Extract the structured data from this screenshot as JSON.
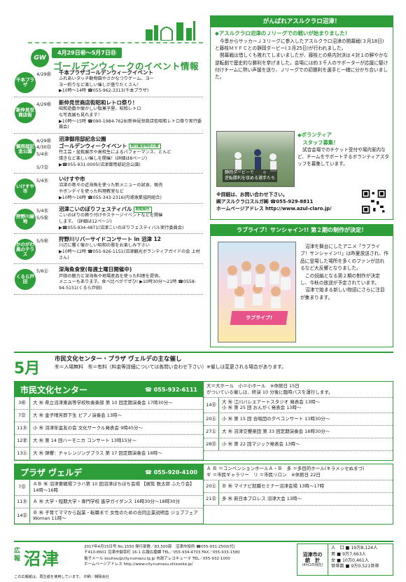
{
  "header": {
    "badge": "GW",
    "dates": "4月29日㊗～5月7日㊐",
    "title": "ゴールデンウィークのイベント情報"
  },
  "events": [
    {
      "loc": "千本プラザ",
      "date": "4/29㊗",
      "title": "千本プラザゴールデンウィークイベント",
      "lines": [
        "ふれあいタッチ動物園やさかなつりゲーム、ヨー",
        "ヨー釣りなど楽しい催しが盛りだくさん！",
        "▶10時～14時 ☎055-962-3313(千本プラザ)"
      ],
      "tag": ""
    },
    {
      "loc": "新仲見世商店街",
      "date": "4/29㊗",
      "title": "新仲見世商店街昭和レトロ祭り！",
      "lines": [
        "昭和遊戯や懐かしい駄菓子屋、昭和レトロ",
        "な写真展も見れます！",
        "▶10時～15時 ☎090-1984-7628(新仲見世商店街昭和レトロ祭り実行委員会)"
      ],
      "tag": ""
    },
    {
      "loc": "御用邸記念公園",
      "date": "4/29㊗\n4/30㊐\n5/4㊍\n\n5/7㊐",
      "title": "沼津御用邸記念公園\nゴールデンウィークイベント",
      "lines": [
        "竹工芸・盆栽展示や高校生によるパフォーマンス、とんど",
        "焼きなど楽しい催しを開催！(詳細は8ページ)",
        "▶☎055-931-0005(沼津御用邸記念公園)"
      ],
      "tag": "西付属邸特別公開"
    },
    {
      "loc": "いけすや市",
      "date": "5/4㊍",
      "title": "いけすや市",
      "lines": [
        "沼津の島々の近海魚を使った新メニューの試食、販売",
        "やボンデイを使った料理教室など",
        "▶10時～16時 ☎055-343-2316(内浦漁業協同組合)"
      ],
      "tag": ""
    },
    {
      "loc": "狩野川緑地",
      "date": "5/4㊍\n5/5㊗",
      "title": "沼津こいのぼりフェスティバル",
      "lines": [
        "こいのぼりの飾り付けやステージイベントなどを開催",
        "します。 (詳細は12ページ)",
        "▶☎055-934-4871(沼津こいのぼりフェスティバル実行委員会)"
      ],
      "tag": "期間展示"
    },
    {
      "loc": "かのがわ風のテラス",
      "date": "5/5㊗",
      "title": "狩野川リバーサイドコンサート in 沼津 12",
      "lines": [
        "川辺に響く懐かしい昭和の歌をお楽しみ下さい",
        "▶10時～12時 ☎055-926-1151(沼津観光ボランティアガイドの会 上村さん)"
      ],
      "tag": ""
    },
    {
      "loc": "くるら戸田",
      "date": "5/6㊏",
      "title": "深海魚食堂(毎週土曜日開催中)",
      "lines": [
        "戸田の魅力と深海魚や地場産品を使った料理を提供。",
        "メニューもあります。食べ比べがでぜひ! ▶10時30分～21時 ☎0558-94-5151(くるら戸田)"
      ],
      "tag": ""
    }
  ],
  "rugby": {
    "header": "がんばれアスルクラロ沼津！",
    "subtitle": "◆アスルクラロ沼津のＪリーグでの戦いが始まりました！",
    "p1": "今季からサッカーＪ３リーグに参入したアスルクラロ沼津の開幕戦(３月18日)と藤枝ＭＹＦＣとの静岡ダービー(３月25日)が行われました。",
    "p2": "開幕戦は惜しくも敗れてしまいましたが、藤枝との県内対決は４対１の鮮やかな逆転劇で歴史的な勝利を挙げました。会場には約３千人のサポーターが応援に駆け付けチームに熱い声援を送り、Ｊリーグでの初勝利を選手と一緒に分かち合いました。",
    "photo_caption": "静岡ダービーで\n逆転勝利を収める選手たち",
    "vol_title": "◆ボランティア\n　スタッフ募集！",
    "vol_text": "試合会場でのチケット受付や場内案内など、チームをサポートするボランティアスタッフを募集しています。",
    "inq1": "※詳細は、お問い合わせ下さい。",
    "inq2": "㈱アスルクラロスルガ㈱ ☎055-929-8811",
    "inq3": "ホームページアドレス http://www.azul-claro.jp/"
  },
  "anime": {
    "header": "ラブライブ！サンシャイン!! 第２期の制作が決定！",
    "logo": "ラブライブ!",
    "p1": "沼津を舞台にしたアニメ「ラブライブ！サンシャイン!!」は昨夏放送され、作品に登場した場所を多くのファンが訪れるなど大反響となりました。",
    "p2": "この続編となる第２期の制作が決定し、今秋の放送が予定されています。",
    "p3": "沼津で始まる新しい物語にさらに注目が集まります。"
  },
  "may": {
    "month": "5月",
    "title": "市民文化センター・プラザ ヴェルデの主な催し",
    "legend": "㊒＝入場無料　㊒＝有料（料金等詳細については各問い合わせ下さい）※催しは変更される場合があります。",
    "venue1": {
      "name": "市民文化センター",
      "tel": "☎ 055-932-6111",
      "note1": "大＝大ホール　小＝小ホール　※休館日 15日",
      "note2": "がついている催しは、終演 10 分後に臨時バスを運行します。",
      "left": [
        {
          "d": "3㊗",
          "c": "大 ㊒ 県立沼津東高等学校吹奏楽部 第 10 回定期演奏会 17時30分～"
        },
        {
          "d": "7㊐",
          "c": "大 ㊒ 金子晴芳即下生 ピアノ演奏会 13時～"
        },
        {
          "d": "11㊍",
          "c": "小 ㊒ 沼津年金友の会 文化サークル発表会 9時45分～"
        },
        {
          "d": "12㊎",
          "c": "大 ㊒ 第 14 回ハーモニカ コンサート 13時15分～"
        },
        {
          "d": "13㊏",
          "c": "大 ㊒ 弾響：チャレンジングブラス 第 17 回定期演奏会 18時～"
        }
      ],
      "right": [
        {
          "d": "14㊐",
          "c": "大 ㊒ 江川バレエアートスタジオ 発表会 13時～\n小 ㊒ 第 25 回 おんがく発表会 13時～"
        },
        {
          "d": "20㊏",
          "c": "小 ㊒ 第 15 回 合唱団の夕べコンサート 13時30分～"
        },
        {
          "d": "27㊏",
          "c": "大 ㊒ 沼津交響楽団 第 33 回定期演奏会 18時30分～"
        },
        {
          "d": "28㊐",
          "c": "小 ㊒ 第 22 回マジック発表会 13時～"
        }
      ]
    },
    "venue2": {
      "name": "プラザ ヴェルデ",
      "tel": "☎ 055-920-4100",
      "note1": "Ａ Ｂ ＝コンベンションホールＡ・Ｂ　多 ＝多目的ホール(キラメッセぬまづ)",
      "note2": "ギ ＝市民ギャラリー　リ ＝市民リロン　※休館日 22日",
      "left": [
        {
          "d": "7㊐",
          "c": "ＡＢ ㊒ 沼津東戦場フラハ第 10 回沼津ぼちぼち会場 【展覧 数太郎 ふたり会】 14時～16時"
        },
        {
          "d": "11㊍",
          "c": "Ａ ㊒ 大学・短期大学・専門学校 進学ガイダンス 16時30分～18時30分"
        },
        {
          "d": "14㊐",
          "c": "Ｂ ㊒ 子育てママから起業・転職まで 女性のための合同企業説明会 ジョブフェア Woman 11時～"
        }
      ],
      "right": [
        {
          "d": "20㊏",
          "c": "Ｂ ㊒ マイナビ就職セミナー沼津会場 13時～17時"
        },
        {
          "d": "21㊐",
          "c": "多 ㊒ 新日本プロレス 沼津大会 13時～"
        }
      ]
    }
  },
  "footer": {
    "logo_small": "広報",
    "logo_big": "沼津",
    "l1": "2017年4月15日号 No.1550 発行部数／83,500部　沼津市役所 ☎055-931-2500(代)",
    "l2": "〒410-8601 沼津市御幸町 16-1 広報広聴課 TEL／055-934-4703 FAX／055-933-1580",
    "l3": "電子メール kouhou@city.numazu.lg.jp 市政アレコキューマ TEL／055-932-1000",
    "l4": "ホームページアドレス http://www.city.numazu.shizuoka.jp/",
    "note": "この広報紙は、再生紙を使用しています。 印刷／朝陽会社",
    "stats_title": "沼津市の\n統　計",
    "stats_sub": "(4月1日現在)",
    "stats": [
      "人　口 ■ 19万8,124人",
      "男 ■ 9万7,663人",
      "女 ■ 10万0,461人",
      "世帯数 ■ 9万0,521世帯"
    ]
  },
  "colors": {
    "accent": "#2e9e3a"
  }
}
